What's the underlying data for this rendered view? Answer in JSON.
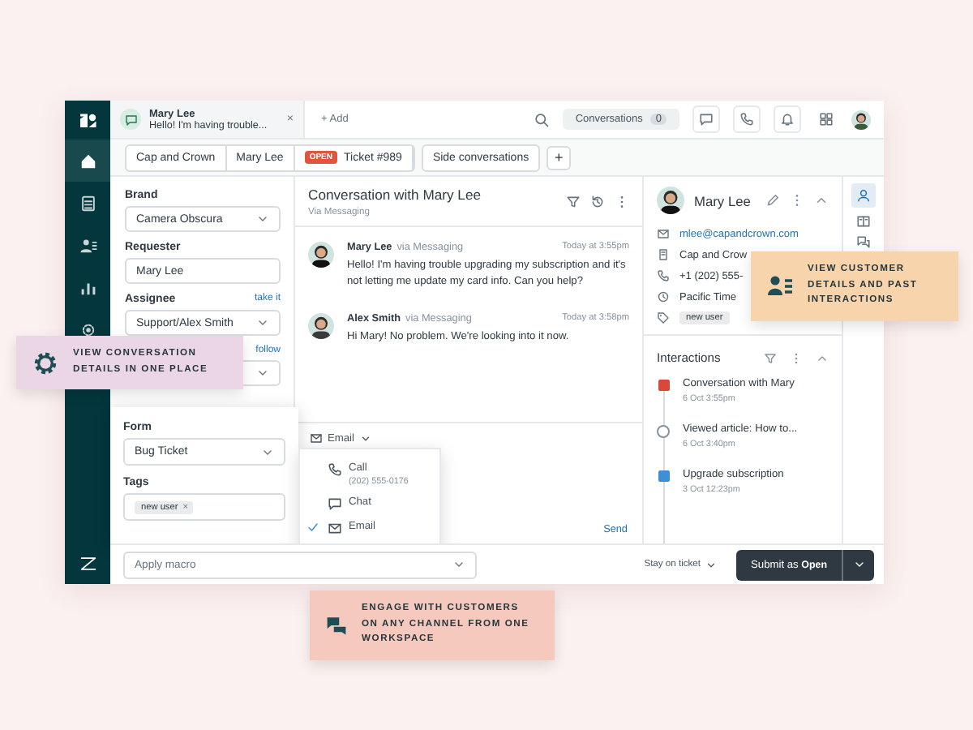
{
  "top_bar": {
    "tab": {
      "name": "Mary Lee",
      "preview": "Hello! I'm having trouble...",
      "close": "×"
    },
    "add": "+ Add",
    "conversations": {
      "label": "Conversations",
      "count": "0"
    }
  },
  "tab_row": {
    "crumbs": [
      {
        "label": "Cap and Crown"
      },
      {
        "label": "Mary Lee"
      },
      {
        "badge": "OPEN",
        "label": "Ticket #989"
      }
    ],
    "side_conversations": "Side conversations",
    "plus": "+"
  },
  "sidebar": {
    "items": [
      {
        "kind": "home",
        "selected": true
      },
      {
        "kind": "views",
        "selected": false
      },
      {
        "kind": "contacts",
        "selected": false
      },
      {
        "kind": "reports",
        "selected": false
      },
      {
        "kind": "settings",
        "selected": false
      }
    ]
  },
  "form": {
    "fields": [
      {
        "kind": "select",
        "label": "Brand",
        "value": "Camera Obscura"
      },
      {
        "kind": "text",
        "label": "Requester",
        "value": "Mary Lee"
      },
      {
        "kind": "select",
        "label": "Assignee",
        "link": "take it",
        "value": "Support/Alex Smith"
      },
      {
        "kind": "select",
        "link": "follow"
      }
    ],
    "highlighted": [
      {
        "kind": "select",
        "label": "Form",
        "value": "Bug Ticket"
      },
      {
        "kind": "tags",
        "label": "Tags",
        "tags": [
          {
            "label": "new user",
            "remove": "×"
          }
        ]
      }
    ]
  },
  "conversation": {
    "title": "Conversation with Mary Lee",
    "subtitle": "Via Messaging",
    "messages": [
      {
        "author": "Mary Lee",
        "channel": "via Messaging",
        "time": "Today at 3:55pm",
        "text": "Hello! I'm having trouble upgrading my subscription and it's not letting me update my card info. Can you help?"
      },
      {
        "author": "Alex Smith",
        "channel": "via Messaging",
        "time": "Today at 3:58pm",
        "text": "Hi Mary! No problem. We're looking into it now."
      }
    ],
    "composer": {
      "channel": "Email",
      "send": "Send",
      "menu": [
        {
          "kind": "call",
          "label": "Call",
          "detail": "(202) 555-0176",
          "selected": false
        },
        {
          "kind": "chat",
          "label": "Chat",
          "selected": false
        },
        {
          "kind": "email",
          "label": "Email",
          "selected": true
        }
      ]
    }
  },
  "customer": {
    "name": "Mary Lee",
    "details": [
      {
        "kind": "email",
        "text": "mlee@capandcrown.com"
      },
      {
        "kind": "org",
        "text": "Cap and Crow"
      },
      {
        "kind": "phone",
        "text": "+1 (202) 555-"
      },
      {
        "kind": "time",
        "text": "Pacific Time"
      },
      {
        "kind": "tag",
        "text": "new user"
      }
    ],
    "interactions": {
      "title": "Interactions",
      "items": [
        {
          "kind": "ticket",
          "color": "#d9483b",
          "title": "Conversation with Mary",
          "time": "6 Oct 3:55pm"
        },
        {
          "kind": "article",
          "title": "Viewed article: How to...",
          "time": "6 Oct 3:40pm"
        },
        {
          "kind": "ticket",
          "color": "#3d8fd6",
          "title": "Upgrade subscription",
          "time": "3 Oct 12:23pm"
        }
      ]
    }
  },
  "bottom_bar": {
    "macro": "Apply macro",
    "stay": "Stay on ticket",
    "submit": "Submit as",
    "status": "Open"
  },
  "callouts": [
    {
      "kind": "conversation",
      "text": "VIEW CONVERSATION DETAILS IN ONE PLACE"
    },
    {
      "kind": "customer",
      "text": "VIEW CUSTOMER DETAILS AND PAST INTERACTIONS"
    },
    {
      "kind": "channels",
      "text": "ENGAGE WITH CUSTOMERS ON ANY CHANNEL FROM ONE WORKSPACE"
    }
  ]
}
